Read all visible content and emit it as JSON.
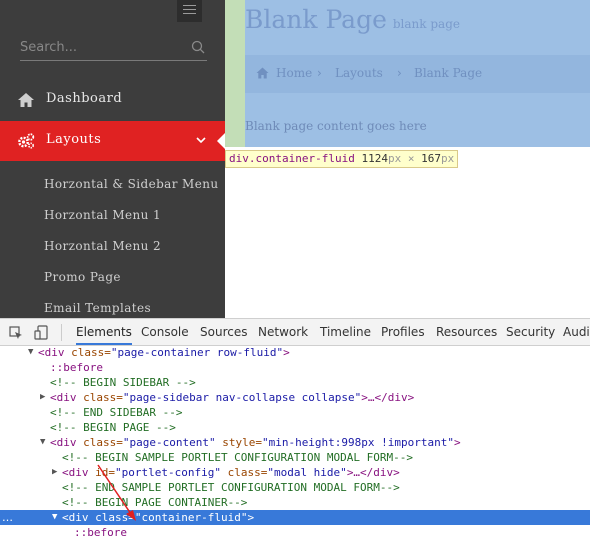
{
  "sidebar": {
    "search_placeholder": "Search...",
    "nav": {
      "dashboard": {
        "label": "Dashboard",
        "icon": "home-icon"
      },
      "layouts": {
        "label": "Layouts",
        "icon": "cogs-icon",
        "active_color": "#e02222"
      }
    },
    "submenu": [
      "Horzontal & Sidebar Menu",
      "Horzontal Menu 1",
      "Horzontal Menu 2",
      "Promo Page",
      "Email Templates"
    ]
  },
  "page": {
    "title": "Blank Page",
    "subtitle": "blank page",
    "breadcrumb": [
      "Home",
      "Layouts",
      "Blank Page"
    ],
    "content_text": "Blank page content goes here"
  },
  "tooltip": {
    "tag": "div.container-fluid",
    "width": "1124",
    "height": "167",
    "unit": "px",
    "times": "×"
  },
  "devtools": {
    "tabs": [
      "Elements",
      "Console",
      "Sources",
      "Network",
      "Timeline",
      "Profiles",
      "Resources",
      "Security",
      "Audi"
    ],
    "active_tab": "Elements",
    "dom": {
      "l0": {
        "tag_open": "<div ",
        "attr": "class=",
        "val": "\"page-container row-fluid\"",
        "tag_close": ">"
      },
      "l1": "::before",
      "l2": "<!-- BEGIN SIDEBAR -->",
      "l3": {
        "tag_open": "<div ",
        "attr": "class=",
        "val": "\"page-sidebar nav-collapse collapse\"",
        "tag_close": ">…</div>"
      },
      "l4": "<!-- END SIDEBAR -->",
      "l5": "<!-- BEGIN PAGE -->",
      "l6": {
        "tag_open": "<div ",
        "attr": "class=",
        "val": "\"page-content\"",
        "attr2": " style=",
        "val2": "\"min-height:998px !important\"",
        "tag_close": ">"
      },
      "l7": "<!-- BEGIN SAMPLE PORTLET CONFIGURATION MODAL FORM-->",
      "l8": {
        "tag_open": "<div ",
        "attr": "id=",
        "val": "\"portlet-config\"",
        "attr2": " class=",
        "val2": "\"modal hide\"",
        "tag_close": ">…</div>"
      },
      "l9": "<!-- END SAMPLE PORTLET CONFIGURATION MODAL FORM-->",
      "l10": "<!-- BEGIN PAGE CONTAINER-->",
      "l11": {
        "dots": "…",
        "tag_open": "<div ",
        "attr": "class=",
        "val": "\"container-fluid\"",
        "tag_close": ">"
      },
      "l12": "::before"
    }
  },
  "colors": {
    "sidebar_bg": "#3d3d3d",
    "accent_red": "#e02222",
    "highlight_blue": "#9dbfe4",
    "padding_green": "#c3deb7",
    "selection_blue": "#3879d9"
  }
}
